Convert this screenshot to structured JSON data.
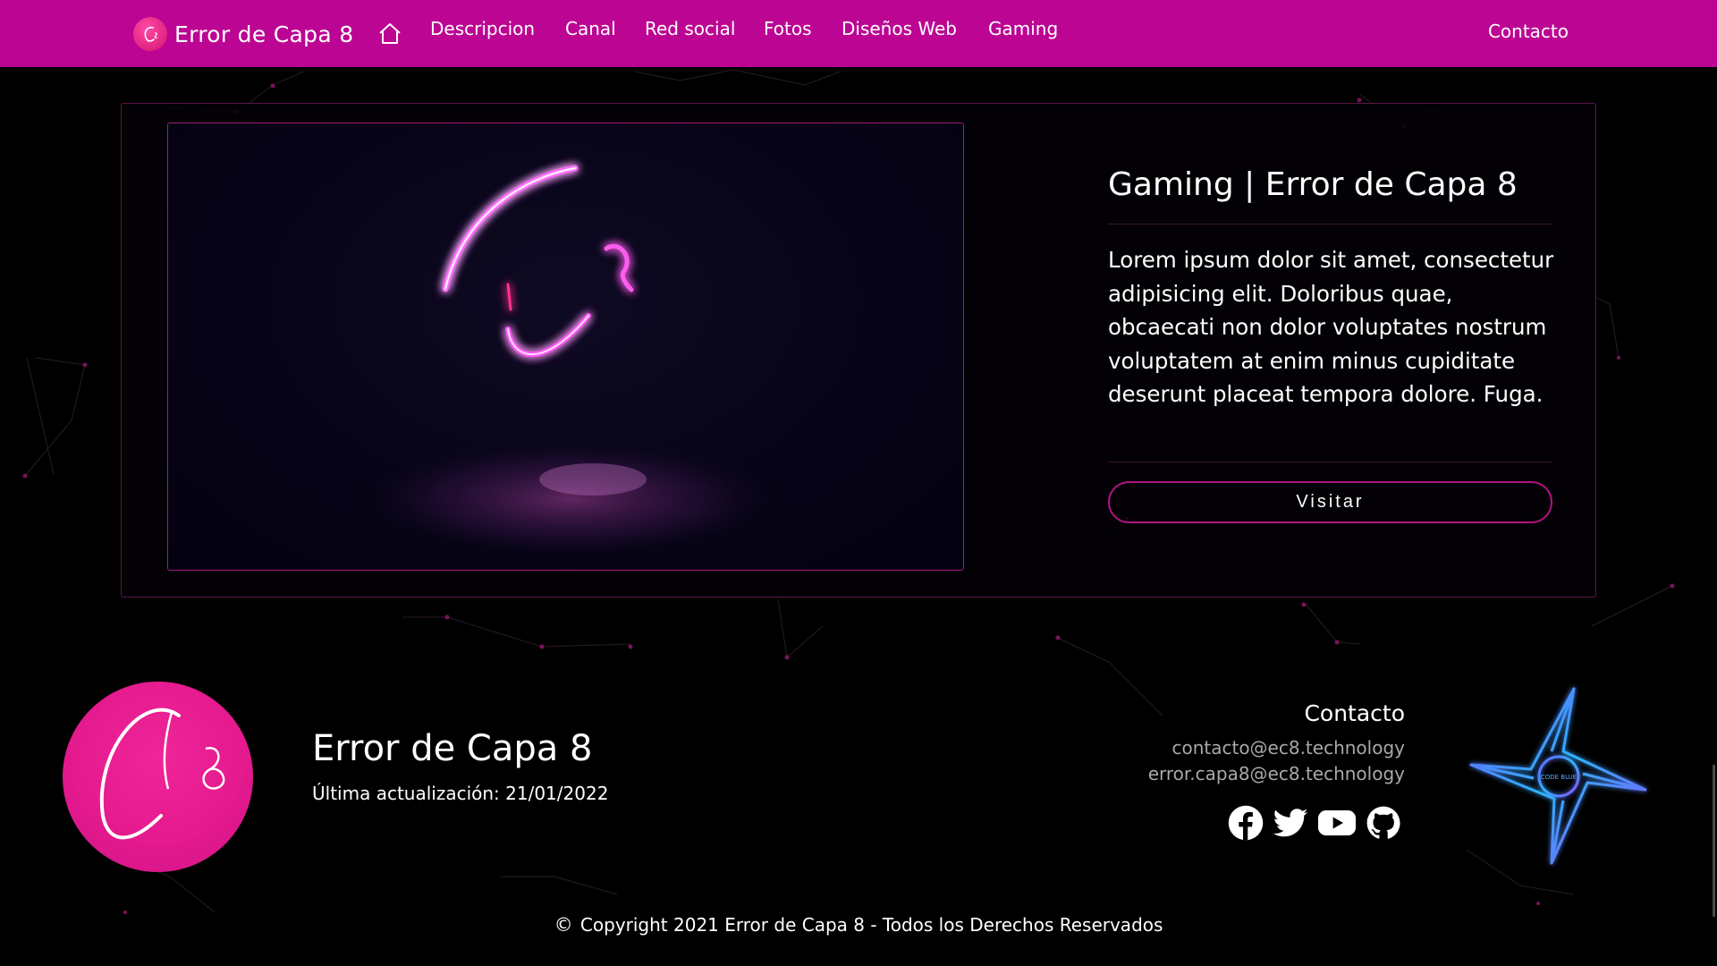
{
  "navbar": {
    "brand": "Error de Capa 8",
    "links": [
      "Descripcion",
      "Canal",
      "Red social",
      "Fotos",
      "Diseños Web",
      "Gaming"
    ],
    "contact": "Contacto",
    "bg_color": "#bc0693"
  },
  "card": {
    "title": "Gaming | Error de Capa 8",
    "text": "Lorem ipsum dolor sit amet, consectetur adipisicing elit. Doloribus quae, obcaecati non dolor voluptates nostrum voluptatem at enim minus cupiditate deserunt placeat tempora dolore. Fuga.",
    "button": "Visitar"
  },
  "footer": {
    "title": "Error de Capa 8",
    "updated": "Última actualización: 21/01/2022",
    "contact_heading": "Contacto",
    "emails": [
      "contacto@ec8.technology",
      "error.capa8@ec8.technology"
    ],
    "social": [
      "facebook-icon",
      "twitter-icon",
      "youtube-icon",
      "github-icon"
    ],
    "badge_text": "CODE BLUE",
    "copyright": "Copyright 2021 Error de Capa 8 - Todos los Derechos Reservados"
  },
  "colors": {
    "accent": "#bc0693",
    "logo_pink": "#e51a8e",
    "border": "#a01a7c"
  }
}
